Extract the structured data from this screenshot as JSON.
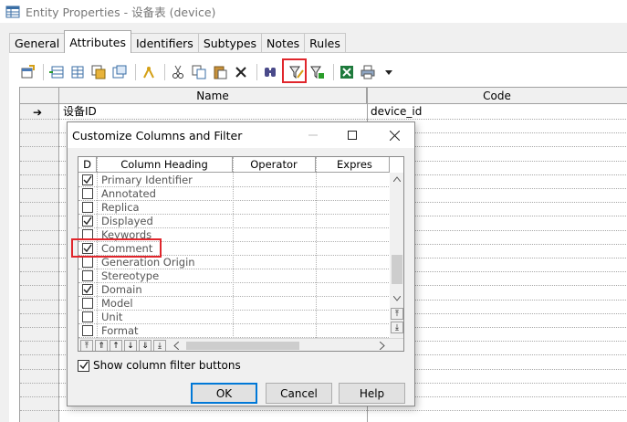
{
  "window": {
    "title": "Entity Properties - 设备表 (device)"
  },
  "tabs": [
    "General",
    "Attributes",
    "Identifiers",
    "Subtypes",
    "Notes",
    "Rules"
  ],
  "active_tab": "Attributes",
  "toolbar": {
    "icons": [
      "properties-icon",
      "insert-row-icon",
      "add-row-icon",
      "add-attributes-icon",
      "reuse-attributes-icon",
      "find-icon",
      "cut-icon",
      "copy-icon",
      "paste-icon",
      "delete-icon",
      "find-in-list-icon",
      "customize-filter-icon",
      "filter-icon",
      "excel-export-icon",
      "print-icon",
      "dropdown-arrow-icon"
    ]
  },
  "grid": {
    "columns": [
      "Name",
      "Code"
    ],
    "rows": [
      {
        "name": "设备ID",
        "code": "device_id",
        "current": true
      }
    ]
  },
  "dialog": {
    "title": "Customize Columns and Filter",
    "columns": [
      "D",
      "Column Heading",
      "Operator",
      "Expres"
    ],
    "rows": [
      {
        "label": "Primary Identifier",
        "checked": true
      },
      {
        "label": "Annotated",
        "checked": false
      },
      {
        "label": "Replica",
        "checked": false
      },
      {
        "label": "Displayed",
        "checked": true
      },
      {
        "label": "Keywords",
        "checked": false
      },
      {
        "label": "Comment",
        "checked": true
      },
      {
        "label": "Generation Origin",
        "checked": false
      },
      {
        "label": "Stereotype",
        "checked": false
      },
      {
        "label": "Domain",
        "checked": true
      },
      {
        "label": "Model",
        "checked": false
      },
      {
        "label": "Unit",
        "checked": false
      },
      {
        "label": "Format",
        "checked": false
      }
    ],
    "show_filter_label": "Show column filter buttons",
    "show_filter_checked": true,
    "buttons": {
      "ok": "OK",
      "cancel": "Cancel",
      "help": "Help"
    }
  },
  "colors": {
    "highlight": "#e0262c",
    "accent": "#0078d7"
  }
}
